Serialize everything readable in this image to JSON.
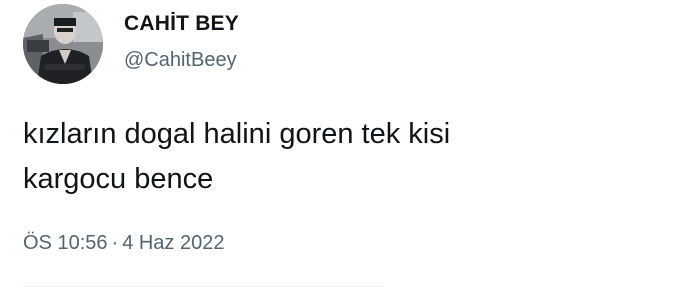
{
  "author": {
    "display_name": "CAHİT BEY",
    "handle": "@CahitBeey"
  },
  "tweet": {
    "lines": [
      "kızların dogal halini goren tek kisi",
      "kargocu bence"
    ]
  },
  "meta": {
    "time": "ÖS 10:56",
    "separator": "·",
    "date": "4 Haz 2022"
  },
  "colors": {
    "text_primary": "#0f1419",
    "text_secondary": "#536471",
    "background": "#ffffff"
  }
}
